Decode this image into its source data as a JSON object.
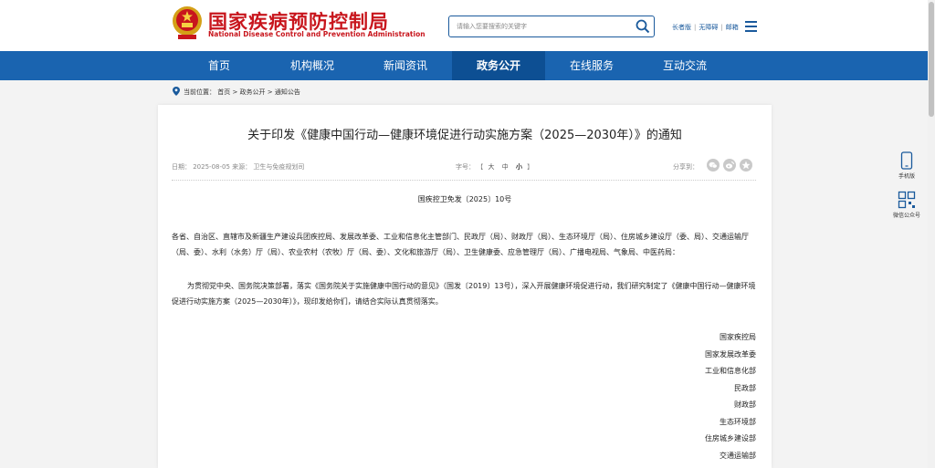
{
  "header": {
    "logo_cn": "国家疾病预防控制局",
    "logo_en": "National Disease Control and Prevention Administration",
    "search_placeholder": "请输入您要搜索的关键字",
    "links": [
      "长者版",
      "无障碍",
      "邮箱"
    ]
  },
  "nav": {
    "items": [
      "首页",
      "机构概况",
      "新闻资讯",
      "政务公开",
      "在线服务",
      "互动交流"
    ],
    "active": "政务公开"
  },
  "breadcrumb": "当前位置： 首页 > 政务公开 > 通知公告",
  "article": {
    "title": "关于印发《健康中国行动—健康环境促进行动实施方案（2025—2030年）》的通知",
    "meta": "日期：  2025-08-05  来源：  卫生与免疫规划司",
    "fontsize_label": "字号：",
    "fontsize_open": "【",
    "fontsize_options": [
      "大",
      "中",
      "小"
    ],
    "fontsize_close": "】",
    "share_label": "分享到：",
    "doc_number": "国疾控卫免发〔2025〕10号",
    "recipients": "各省、自治区、直辖市及新疆生产建设兵团疾控局、发展改革委、工业和信息化主管部门、民政厅（局）、财政厅（局）、生态环境厅（局）、住房城乡建设厅（委、局）、交通运输厅（局、委）、水利（水务）厅（局）、农业农村（农牧）厅（局、委）、文化和旅游厅（局）、卫生健康委、应急管理厅（局）、广播电视局、气象局、中医药局：",
    "body": "为贯彻党中央、国务院决策部署，落实《国务院关于实施健康中国行动的意见》（国发〔2019〕13号），深入开展健康环境促进行动，我们研究制定了《健康中国行动—健康环境促进行动实施方案（2025—2030年）》，现印发给你们，请结合实际认真贯彻落实。",
    "signers": [
      "国家疾控局",
      "国家发展改革委",
      "工业和信息化部",
      "民政部",
      "财政部",
      "生态环境部",
      "住房城乡建设部",
      "交通运输部"
    ]
  },
  "float": {
    "mobile_label": "手机版",
    "wechat_label": "微信公众号"
  },
  "colors": {
    "brand_red": "#c8161d",
    "nav_blue": "#1a64b0",
    "nav_active": "#0d4f93"
  }
}
